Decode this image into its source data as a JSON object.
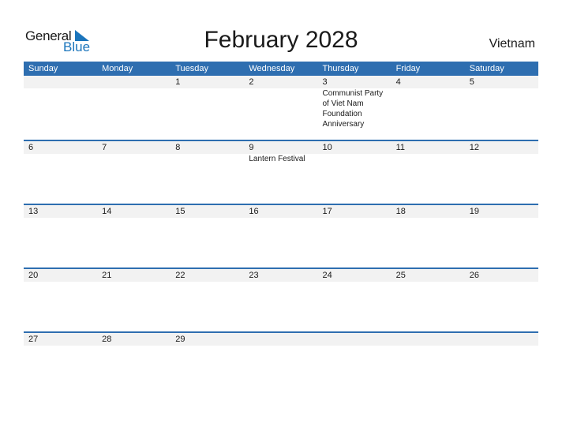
{
  "brand": {
    "line1": "General",
    "line2": "Blue",
    "accent": "#1b75bc"
  },
  "title": "February 2028",
  "country": "Vietnam",
  "header_color": "#2e6eb0",
  "weekdays": [
    "Sunday",
    "Monday",
    "Tuesday",
    "Wednesday",
    "Thursday",
    "Friday",
    "Saturday"
  ],
  "weeks": [
    {
      "days": [
        "",
        "",
        "1",
        "2",
        "3",
        "4",
        "5"
      ],
      "events": [
        "",
        "",
        "",
        "",
        "Communist Party of Viet Nam Foundation Anniversary",
        "",
        ""
      ]
    },
    {
      "days": [
        "6",
        "7",
        "8",
        "9",
        "10",
        "11",
        "12"
      ],
      "events": [
        "",
        "",
        "",
        "Lantern Festival",
        "",
        "",
        ""
      ]
    },
    {
      "days": [
        "13",
        "14",
        "15",
        "16",
        "17",
        "18",
        "19"
      ],
      "events": [
        "",
        "",
        "",
        "",
        "",
        "",
        ""
      ]
    },
    {
      "days": [
        "20",
        "21",
        "22",
        "23",
        "24",
        "25",
        "26"
      ],
      "events": [
        "",
        "",
        "",
        "",
        "",
        "",
        ""
      ]
    },
    {
      "days": [
        "27",
        "28",
        "29",
        "",
        "",
        "",
        ""
      ],
      "events": [
        "",
        "",
        "",
        "",
        "",
        "",
        ""
      ]
    }
  ]
}
